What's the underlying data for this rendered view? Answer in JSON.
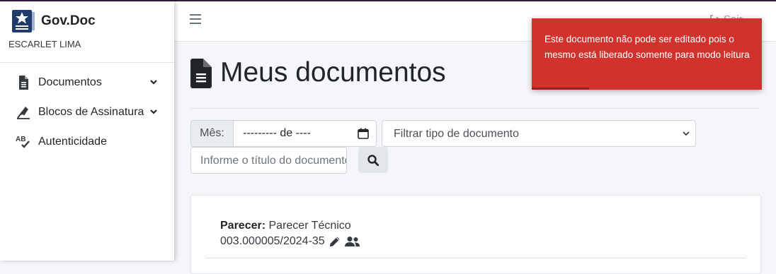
{
  "app": {
    "name": "Gov.Doc",
    "user": "ESCARLET LIMA"
  },
  "sidebar": {
    "items": [
      {
        "label": "Documentos",
        "icon": "file-icon",
        "has_submenu": true
      },
      {
        "label": "Blocos de Assinatura",
        "icon": "signature-icon",
        "has_submenu": true
      },
      {
        "label": "Autenticidade",
        "icon": "spell-check-icon",
        "has_submenu": false
      }
    ]
  },
  "header": {
    "logout_label": "Sair"
  },
  "page": {
    "title": "Meus documentos"
  },
  "filters": {
    "month_label": "Mês:",
    "month_value": "--------- de ----",
    "type_select_value": "Filtrar tipo de documento",
    "title_placeholder": "Informe o título do documento"
  },
  "documents": [
    {
      "type_label": "Parecer:",
      "type_value": "Parecer Técnico",
      "number": "003.000005/2024-35"
    }
  ],
  "toast": {
    "message": "Este documento não pode ser editado pois o mesmo está liberado somente para modo leitura",
    "color": "#d2322d",
    "progress": 0.25
  }
}
